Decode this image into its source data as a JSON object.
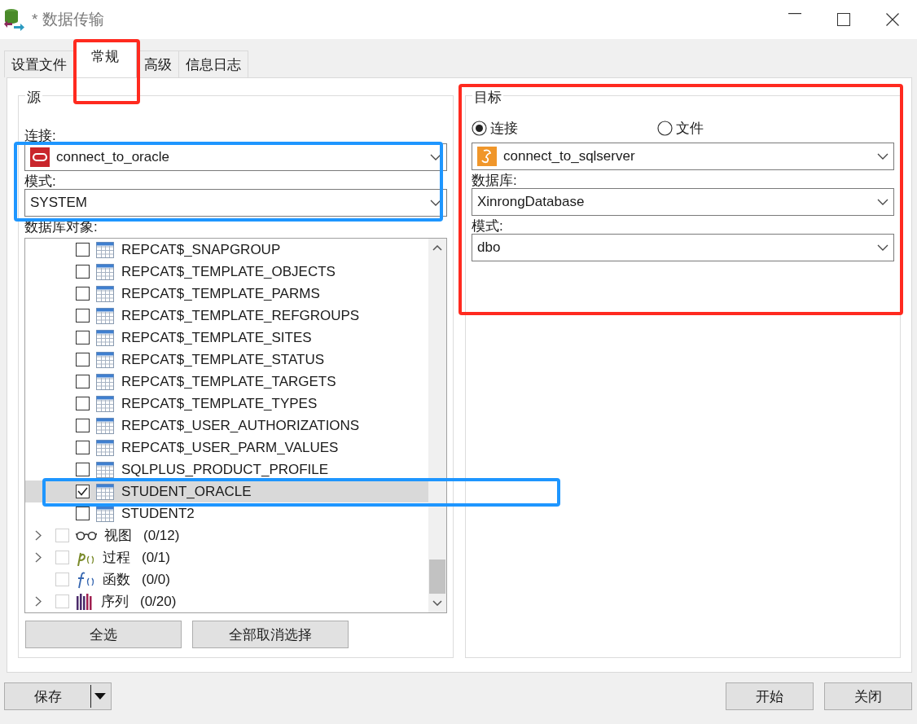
{
  "window": {
    "title": "* 数据传输"
  },
  "tabs": [
    {
      "label": "设置文件",
      "selected": false
    },
    {
      "label": "常规",
      "selected": true
    },
    {
      "label": "高级",
      "selected": false
    },
    {
      "label": "信息日志",
      "selected": false
    }
  ],
  "source": {
    "legend": "源",
    "connection_label": "连接:",
    "connection": "connect_to_oracle",
    "schema_label": "模式:",
    "schema": "SYSTEM",
    "objects_label": "数据库对象:",
    "tree": [
      {
        "kind": "table",
        "label": "REPCAT$_SNAPGROUP",
        "checked": false,
        "selected": false
      },
      {
        "kind": "table",
        "label": "REPCAT$_TEMPLATE_OBJECTS",
        "checked": false,
        "selected": false
      },
      {
        "kind": "table",
        "label": "REPCAT$_TEMPLATE_PARMS",
        "checked": false,
        "selected": false
      },
      {
        "kind": "table",
        "label": "REPCAT$_TEMPLATE_REFGROUPS",
        "checked": false,
        "selected": false
      },
      {
        "kind": "table",
        "label": "REPCAT$_TEMPLATE_SITES",
        "checked": false,
        "selected": false
      },
      {
        "kind": "table",
        "label": "REPCAT$_TEMPLATE_STATUS",
        "checked": false,
        "selected": false
      },
      {
        "kind": "table",
        "label": "REPCAT$_TEMPLATE_TARGETS",
        "checked": false,
        "selected": false
      },
      {
        "kind": "table",
        "label": "REPCAT$_TEMPLATE_TYPES",
        "checked": false,
        "selected": false
      },
      {
        "kind": "table",
        "label": "REPCAT$_USER_AUTHORIZATIONS",
        "checked": false,
        "selected": false
      },
      {
        "kind": "table",
        "label": "REPCAT$_USER_PARM_VALUES",
        "checked": false,
        "selected": false
      },
      {
        "kind": "table",
        "label": "SQLPLUS_PRODUCT_PROFILE",
        "checked": false,
        "selected": false
      },
      {
        "kind": "table",
        "label": "STUDENT_ORACLE",
        "checked": true,
        "selected": true
      },
      {
        "kind": "table",
        "label": "STUDENT2",
        "checked": false,
        "selected": false
      },
      {
        "kind": "view",
        "label": "视图",
        "count": "(0/12)",
        "checked": false,
        "selected": false,
        "expandable": true
      },
      {
        "kind": "procedure",
        "label": "过程",
        "count": "(0/1)",
        "checked": false,
        "selected": false,
        "expandable": true
      },
      {
        "kind": "function",
        "label": "函数",
        "count": "(0/0)",
        "checked": false,
        "selected": false,
        "expandable": false
      },
      {
        "kind": "sequence",
        "label": "序列",
        "count": "(0/20)",
        "checked": false,
        "selected": false,
        "expandable": true
      }
    ],
    "buttons": [
      "全选",
      "全部取消选择"
    ]
  },
  "target": {
    "legend": "目标",
    "options": [
      {
        "label": "连接",
        "selected": true
      },
      {
        "label": "文件",
        "selected": false
      }
    ],
    "connection": "connect_to_sqlserver",
    "database_label": "数据库:",
    "database": "XinrongDatabase",
    "schema_label": "模式:",
    "schema": "dbo"
  },
  "footer": {
    "save": "保存",
    "buttons": [
      "开始",
      "关闭"
    ]
  },
  "annotations": [
    {
      "kind": "tab",
      "color": "#ff2a1f"
    },
    {
      "kind": "source-fields",
      "color": "#1e96ff"
    },
    {
      "kind": "tree-row",
      "color": "#1e96ff"
    },
    {
      "kind": "target-group",
      "color": "#ff2a1f"
    }
  ]
}
